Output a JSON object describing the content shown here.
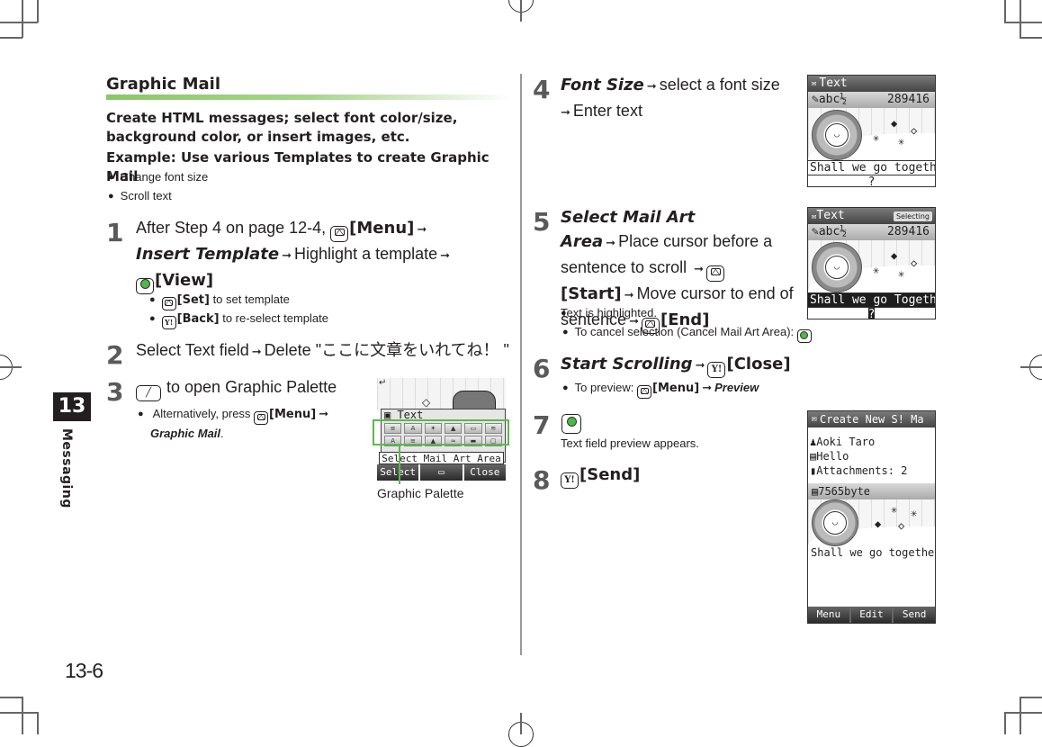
{
  "chapter": {
    "number": "13",
    "label": "Messaging"
  },
  "page_number": "13-6",
  "section": {
    "title": "Graphic Mail",
    "intro": "Create HTML messages; select font color/size, background color, or insert images, etc.",
    "example": "Example: Use various Templates to create Graphic Mail",
    "example_bullets": [
      "Change font size",
      "Scroll text"
    ]
  },
  "steps": [
    {
      "num": "1",
      "parts": {
        "a": "After Step 4 on page 12-4,",
        "menu": "[Menu]",
        "insert_template": "Insert Template",
        "b": "Highlight a template",
        "view": "[View]"
      },
      "bullets": [
        {
          "key": "[Set]",
          "text": "to set template"
        },
        {
          "key": "[Back]",
          "text": "to re-select template"
        }
      ]
    },
    {
      "num": "2",
      "text_a": "Select Text field",
      "text_b": "Delete \"ここに文章をいれてね！ \""
    },
    {
      "num": "3",
      "text": "to open Graphic Palette",
      "bullet": {
        "a": "Alternatively, press",
        "key": "[Menu]",
        "italic": "Graphic Mail",
        "end": "."
      },
      "callout": "Graphic Palette"
    },
    {
      "num": "4",
      "italic": "Font Size",
      "text_a": "select a font size",
      "text_b": "Enter text"
    },
    {
      "num": "5",
      "italic": "Select Mail Art Area",
      "text_a": "Place cursor before a sentence to scroll",
      "start": "[Start]",
      "text_b": "Move cursor to end of sentence",
      "end": "[End]",
      "note": "Text is highlighted.",
      "bullet": "To cancel selection (Cancel Mail Art Area):"
    },
    {
      "num": "6",
      "italic": "Start Scrolling",
      "close": "[Close]",
      "bullet": {
        "a": "To preview:",
        "key": "[Menu]",
        "italic": "Preview"
      }
    },
    {
      "num": "7",
      "note": "Text field preview appears."
    },
    {
      "num": "8",
      "send": "[Send]"
    }
  ],
  "screens": {
    "palette": {
      "title": "Text",
      "select_area": "Select Mail Art Area",
      "softkeys": [
        "Select",
        "",
        "Close"
      ],
      "corner_glyph": "↵"
    },
    "font_size": {
      "title": "Text",
      "mode": "abc½",
      "count": "289416",
      "line1": "Shall we go together",
      "line2": "?"
    },
    "selecting": {
      "title": "Text",
      "badge": "Selecting",
      "mode": "abc½",
      "count": "289416",
      "line1": "Shall we go Together",
      "line2": "?"
    },
    "create_new": {
      "title": "Create New S! Ma",
      "to": "Aoki Taro",
      "subject": "Hello",
      "attachments": "Attachments: 2",
      "size": "7565byte",
      "body": "Shall we go togethe",
      "softkeys": [
        "Menu",
        "Edit",
        "Send"
      ]
    }
  },
  "arrow": "➞",
  "colors": {
    "accent_green": "#5cb84f",
    "chapter_tab": "#231f20"
  }
}
